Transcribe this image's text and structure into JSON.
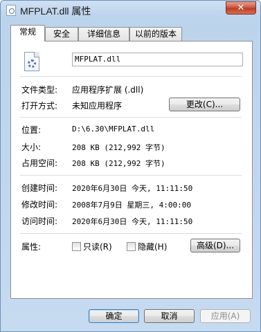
{
  "window": {
    "title": "MFPLAT.dll 属性",
    "close_glyph": "✕"
  },
  "tabs": [
    {
      "label": "常规"
    },
    {
      "label": "安全"
    },
    {
      "label": "详细信息"
    },
    {
      "label": "以前的版本"
    }
  ],
  "general": {
    "file_name": "MFPLAT.dll",
    "icon": "dll-gear-file-icon",
    "type_label": "文件类型:",
    "type_value": "应用程序扩展 (.dll)",
    "opens_with_label": "打开方式:",
    "opens_with_value": "未知应用程序",
    "change_button": "更改(C)...",
    "location_label": "位置:",
    "location_value": "D:\\6.30\\MFPLAT.dll",
    "size_label": "大小:",
    "size_value": "208 KB (212,992 字节)",
    "size_on_disk_label": "占用空间:",
    "size_on_disk_value": "208 KB (212,992 字节)",
    "created_label": "创建时间:",
    "created_value": "2020年6月30日 今天, 11:11:50",
    "modified_label": "修改时间:",
    "modified_value": "2008年7月9日 星期三, 4:00:00",
    "accessed_label": "访问时间:",
    "accessed_value": "2020年6月30日 今天, 11:11:50",
    "attributes_label": "属性:",
    "readonly_label": "只读(R)",
    "hidden_label": "隐藏(H)",
    "advanced_button": "高级(D)..."
  },
  "footer": {
    "ok": "确定",
    "cancel": "取消",
    "apply": "应用(A)"
  }
}
